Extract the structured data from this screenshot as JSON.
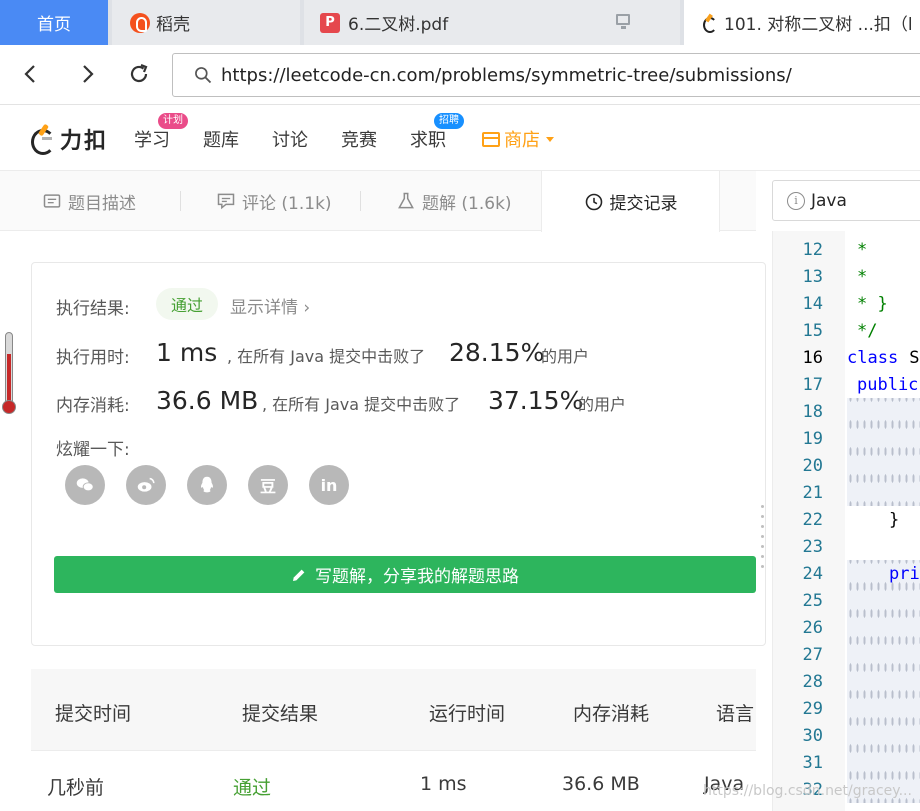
{
  "browser": {
    "tabs": [
      {
        "label": "首页"
      },
      {
        "label": "稻壳"
      },
      {
        "label": "6.二叉树.pdf"
      },
      {
        "label": "101. 对称二叉树 ...扣（l"
      }
    ],
    "url": "https://leetcode-cn.com/problems/symmetric-tree/submissions/"
  },
  "nav": {
    "logo_text": "力扣",
    "items": [
      {
        "label": "学习",
        "badge": "计划"
      },
      {
        "label": "题库"
      },
      {
        "label": "讨论"
      },
      {
        "label": "竞赛"
      },
      {
        "label": "求职",
        "badge": "招聘"
      },
      {
        "label": "商店"
      }
    ],
    "colors": {
      "accent": "#ffa116",
      "badge_red": "#ea4c89",
      "badge_blue": "#1890ff"
    }
  },
  "problem_tabs": [
    {
      "label": "题目描述"
    },
    {
      "label": "评论 (1.1k)"
    },
    {
      "label": "题解 (1.6k)"
    },
    {
      "label": "提交记录"
    }
  ],
  "result": {
    "status_label": "执行结果:",
    "status_value": "通过",
    "details_link": "显示详情 ›",
    "runtime_label": "执行用时:",
    "runtime_value": "1 ms",
    "runtime_mid": ", 在所有 Java 提交中击败了",
    "runtime_pct": "28.15%",
    "runtime_tail": "的用户",
    "memory_label": "内存消耗:",
    "memory_value": "36.6 MB",
    "memory_mid": ", 在所有 Java 提交中击败了",
    "memory_pct": "37.15%",
    "memory_tail": "的用户",
    "share_label": "炫耀一下:",
    "share": [
      "wechat-icon",
      "weibo-icon",
      "qq-icon",
      "douban-icon",
      "linkedin-icon"
    ],
    "douban_glyph": "豆",
    "linkedin_glyph": "in",
    "write_button": "写题解，分享我的解题思路",
    "pass_color": "#46a033",
    "button_color": "#2db55d"
  },
  "submissions": {
    "headers": [
      "提交时间",
      "提交结果",
      "运行时间",
      "内存消耗",
      "语言"
    ],
    "rows": [
      {
        "time": "几秒前",
        "result": "通过",
        "runtime": "1 ms",
        "memory": "36.6 MB",
        "lang": "Java"
      }
    ]
  },
  "editor": {
    "language": "Java",
    "line_numbers": [
      "12",
      "13",
      "14",
      "15",
      "16",
      "17",
      "18",
      "19",
      "20",
      "21",
      "22",
      "23",
      "24",
      "25",
      "26",
      "27",
      "28",
      "29",
      "30",
      "31",
      "32"
    ],
    "current_line": "16",
    "lines": {
      "l12": "*",
      "l13": "*",
      "l14": "* }",
      "l15": "*/",
      "l16_kw": "class",
      "l16_rest": " S",
      "l17": "public",
      "l22": "}",
      "l24": "pri"
    }
  },
  "watermark": "https://blog.csdn.net/gracey..."
}
